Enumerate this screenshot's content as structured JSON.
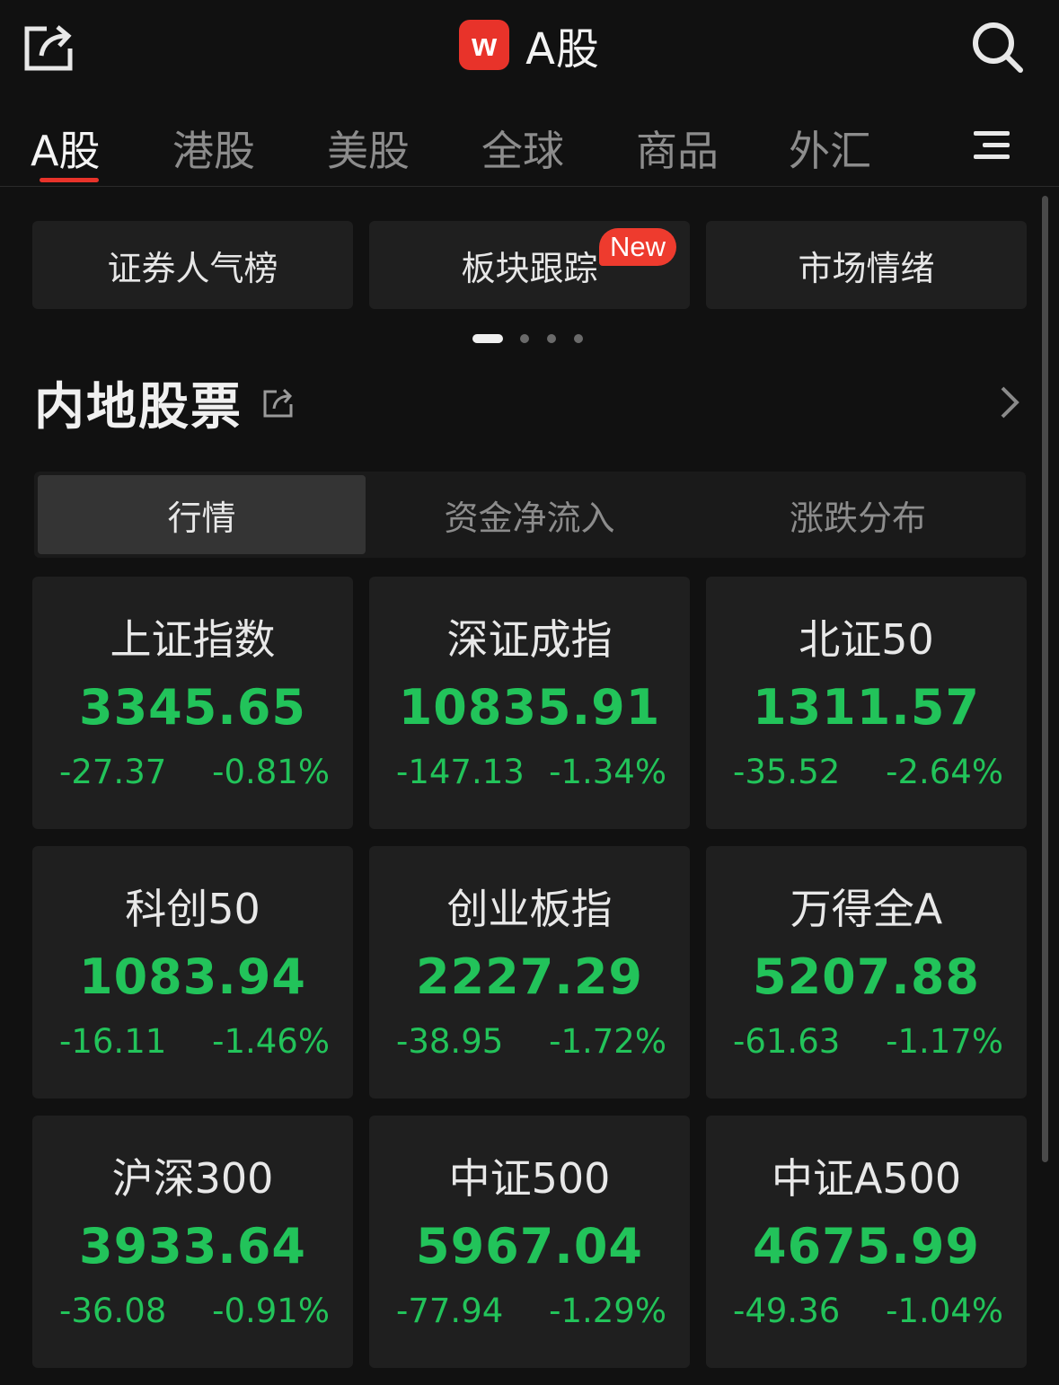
{
  "header": {
    "logo_letter": "w",
    "title": "A股"
  },
  "tabs": [
    {
      "label": "A股"
    },
    {
      "label": "港股"
    },
    {
      "label": "美股"
    },
    {
      "label": "全球"
    },
    {
      "label": "商品"
    },
    {
      "label": "外汇"
    }
  ],
  "quick_links": [
    {
      "label": "证券人气榜"
    },
    {
      "label": "板块跟踪",
      "badge": "New"
    },
    {
      "label": "市场情绪"
    }
  ],
  "section": {
    "title": "内地股票"
  },
  "segments": [
    {
      "label": "行情"
    },
    {
      "label": "资金净流入"
    },
    {
      "label": "涨跌分布"
    }
  ],
  "indices": [
    {
      "name": "上证指数",
      "value": "3345.65",
      "change": "-27.37",
      "pct": "-0.81%"
    },
    {
      "name": "深证成指",
      "value": "10835.91",
      "change": "-147.13",
      "pct": "-1.34%"
    },
    {
      "name": "北证50",
      "value": "1311.57",
      "change": "-35.52",
      "pct": "-2.64%"
    },
    {
      "name": "科创50",
      "value": "1083.94",
      "change": "-16.11",
      "pct": "-1.46%"
    },
    {
      "name": "创业板指",
      "value": "2227.29",
      "change": "-38.95",
      "pct": "-1.72%"
    },
    {
      "name": "万得全A",
      "value": "5207.88",
      "change": "-61.63",
      "pct": "-1.17%"
    },
    {
      "name": "沪深300",
      "value": "3933.64",
      "change": "-36.08",
      "pct": "-0.91%"
    },
    {
      "name": "中证500",
      "value": "5967.04",
      "change": "-77.94",
      "pct": "-1.29%"
    },
    {
      "name": "中证A500",
      "value": "4675.99",
      "change": "-49.36",
      "pct": "-1.04%"
    }
  ],
  "icons": {
    "share": "share-icon",
    "search": "search-icon",
    "menu": "menu-icon",
    "chevron": "chevron-right-icon"
  },
  "colors": {
    "background": "#111111",
    "card": "#1f1f1f",
    "down_green": "#22c35a",
    "accent_red": "#e8332a"
  }
}
